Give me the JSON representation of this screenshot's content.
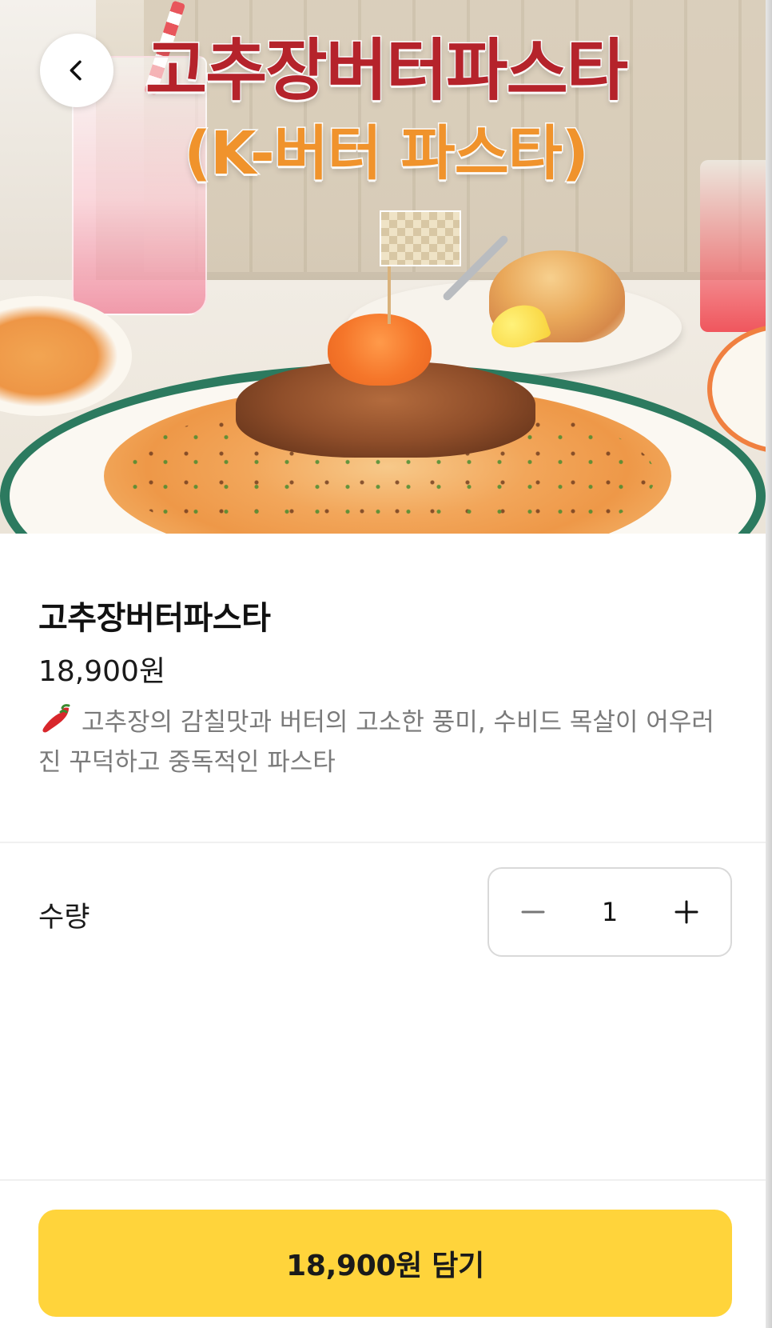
{
  "hero": {
    "title": "고추장버터파스타",
    "subtitle": "(K-버터 파스타)",
    "image_name": "gochujang-butter-pasta-photo",
    "title_color": "#b5232b",
    "subtitle_color": "#f0932c"
  },
  "nav": {
    "back_icon": "chevron-left-icon"
  },
  "product": {
    "name": "고추장버터파스타",
    "price": "18,900원",
    "description_icon": "chili-pepper-icon",
    "description": "고추장의 감칠맛과 버터의 고소한 풍미, 수비드 목살이 어우러진 꾸덕하고 중독적인 파스타"
  },
  "quantity": {
    "label": "수량",
    "value": "1",
    "decrement_icon": "minus-icon",
    "increment_icon": "plus-icon"
  },
  "cta": {
    "label": "18,900원 담기",
    "color": "#ffd43b"
  }
}
